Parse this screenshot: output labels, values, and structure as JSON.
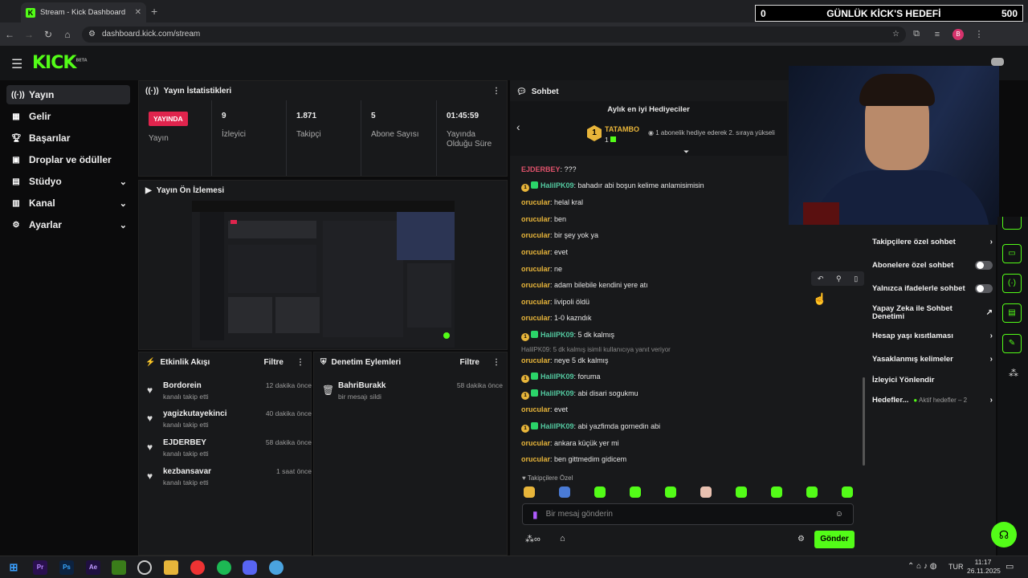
{
  "browser": {
    "tab_title": "Stream - Kick Dashboard",
    "url": "dashboard.kick.com/stream",
    "profile_initial": "B"
  },
  "goal_overlay": {
    "current": "0",
    "title": "GÜNLÜK KİCK'S HEDEFİ",
    "target": "500"
  },
  "brand": {
    "logo": "KICK",
    "logo_sup": "BETA",
    "accent": "#53fc18"
  },
  "sidebar": {
    "items": [
      {
        "label": "Yayın",
        "icon": "broadcast-icon",
        "active": true
      },
      {
        "label": "Gelir",
        "icon": "revenue-icon"
      },
      {
        "label": "Başarılar",
        "icon": "trophy-icon"
      },
      {
        "label": "Droplar ve ödüller",
        "icon": "gift-icon"
      },
      {
        "label": "Stüdyo",
        "icon": "studio-icon",
        "expandable": true
      },
      {
        "label": "Kanal",
        "icon": "channel-icon",
        "expandable": true
      },
      {
        "label": "Ayarlar",
        "icon": "gear-icon",
        "expandable": true
      }
    ]
  },
  "stats": {
    "title": "Yayın İstatistikleri",
    "live_badge": "YAYINDA",
    "live_label": "Yayın",
    "viewers_value": "9",
    "viewers_label": "İzleyici",
    "followers_value": "1.871",
    "followers_label": "Takipçi",
    "subs_value": "5",
    "subs_label": "Abone Sayısı",
    "uptime_value": "01:45:59",
    "uptime_label1": "Yayında",
    "uptime_label2": "Olduğu Süre"
  },
  "preview": {
    "title": "Yayın Ön İzlemesi"
  },
  "activity": {
    "title": "Etkinlik Akışı",
    "filter": "Filtre",
    "items": [
      {
        "name": "Bordorein",
        "desc": "kanalı takip etti",
        "time": "12 dakika önce"
      },
      {
        "name": "yagizkutayekinci",
        "desc": "kanalı takip etti",
        "time": "40 dakika önce"
      },
      {
        "name": "EJDERBEY",
        "desc": "kanalı takip etti",
        "time": "58 dakika önce"
      },
      {
        "name": "kezbansavar",
        "desc": "kanalı takip etti",
        "time": "1 saat önce"
      }
    ]
  },
  "moderation": {
    "title": "Denetim Eylemleri",
    "filter": "Filtre",
    "items": [
      {
        "name": "BahriBurakk",
        "desc": "bir mesajı sildi",
        "time": "58 dakika önce"
      }
    ]
  },
  "chat": {
    "title": "Sohbet",
    "gifters_title": "Aylık en iyi Hediyeciler",
    "top_gifter": "TATAMBO",
    "top_gifter_rank": "1",
    "top_gifter_count": "1",
    "gifter_note": "1 abonelik hediye ederek 2. sıraya yükseli",
    "messages": [
      {
        "user": "EJDERBEY",
        "text": "???",
        "style": "r"
      },
      {
        "user": "HalilPK09",
        "text": "bahadır abi boşun kelime anlamisimisin",
        "style": "g",
        "badges": true
      },
      {
        "user": "orucular",
        "text": "helal kral"
      },
      {
        "user": "orucular",
        "text": "ben"
      },
      {
        "user": "orucular",
        "text": "bir şey yok ya"
      },
      {
        "user": "orucular",
        "text": "evet"
      },
      {
        "user": "orucular",
        "text": "ne"
      },
      {
        "user": "orucular",
        "text": "adam bilebile kendini yere atı"
      },
      {
        "user": "orucular",
        "text": "livipoli öldü"
      },
      {
        "user": "orucular",
        "text": "1-0 kazndık"
      },
      {
        "user": "HalilPK09",
        "text": "5 dk kalmış",
        "style": "g",
        "badges": true
      },
      {
        "user": "orucular",
        "text": "neye 5 dk kalmış",
        "reply": "HalilPK09: 5 dk kalmış isimli kullanıcıya yanıt veriyor"
      },
      {
        "user": "HalilPK09",
        "text": "foruma",
        "style": "g",
        "badges": true
      },
      {
        "user": "HalilPK09",
        "text": "abi disari sogukmu",
        "style": "g",
        "badges": true
      },
      {
        "user": "orucular",
        "text": "evet"
      },
      {
        "user": "HalilPK09",
        "text": "abi yazfimda gornedin abi",
        "style": "g",
        "badges": true
      },
      {
        "user": "orucular",
        "text": "ankara küçük yer mi"
      },
      {
        "user": "orucular",
        "text": "ben gittmedim gidicem"
      }
    ],
    "followers_only_note": "Takipçilere Özel",
    "input_placeholder": "Bir mesaj gönderin",
    "send_label": "Gönder"
  },
  "chat_settings": {
    "items": [
      {
        "label": "Takipçilere özel sohbet",
        "kind": "chevron"
      },
      {
        "label": "Abonelere özel sohbet",
        "kind": "toggle"
      },
      {
        "label": "Yalnızca ifadelerle sohbet",
        "kind": "toggle"
      },
      {
        "label": "Yapay Zeka ile Sohbet Denetimi",
        "kind": "external"
      },
      {
        "label": "Hesap yaşı kısıtlaması",
        "kind": "chevron"
      },
      {
        "label": "Yasaklanmış kelimeler",
        "kind": "chevron"
      },
      {
        "label": "İzleyici Yönlendir",
        "kind": "none"
      },
      {
        "label": "Hedefler...",
        "kind": "chevron"
      }
    ],
    "goals_note": "Aktif hedefler – 2"
  },
  "taskbar": {
    "lang": "TUR",
    "time": "11:17",
    "date": "26.11.2025"
  }
}
